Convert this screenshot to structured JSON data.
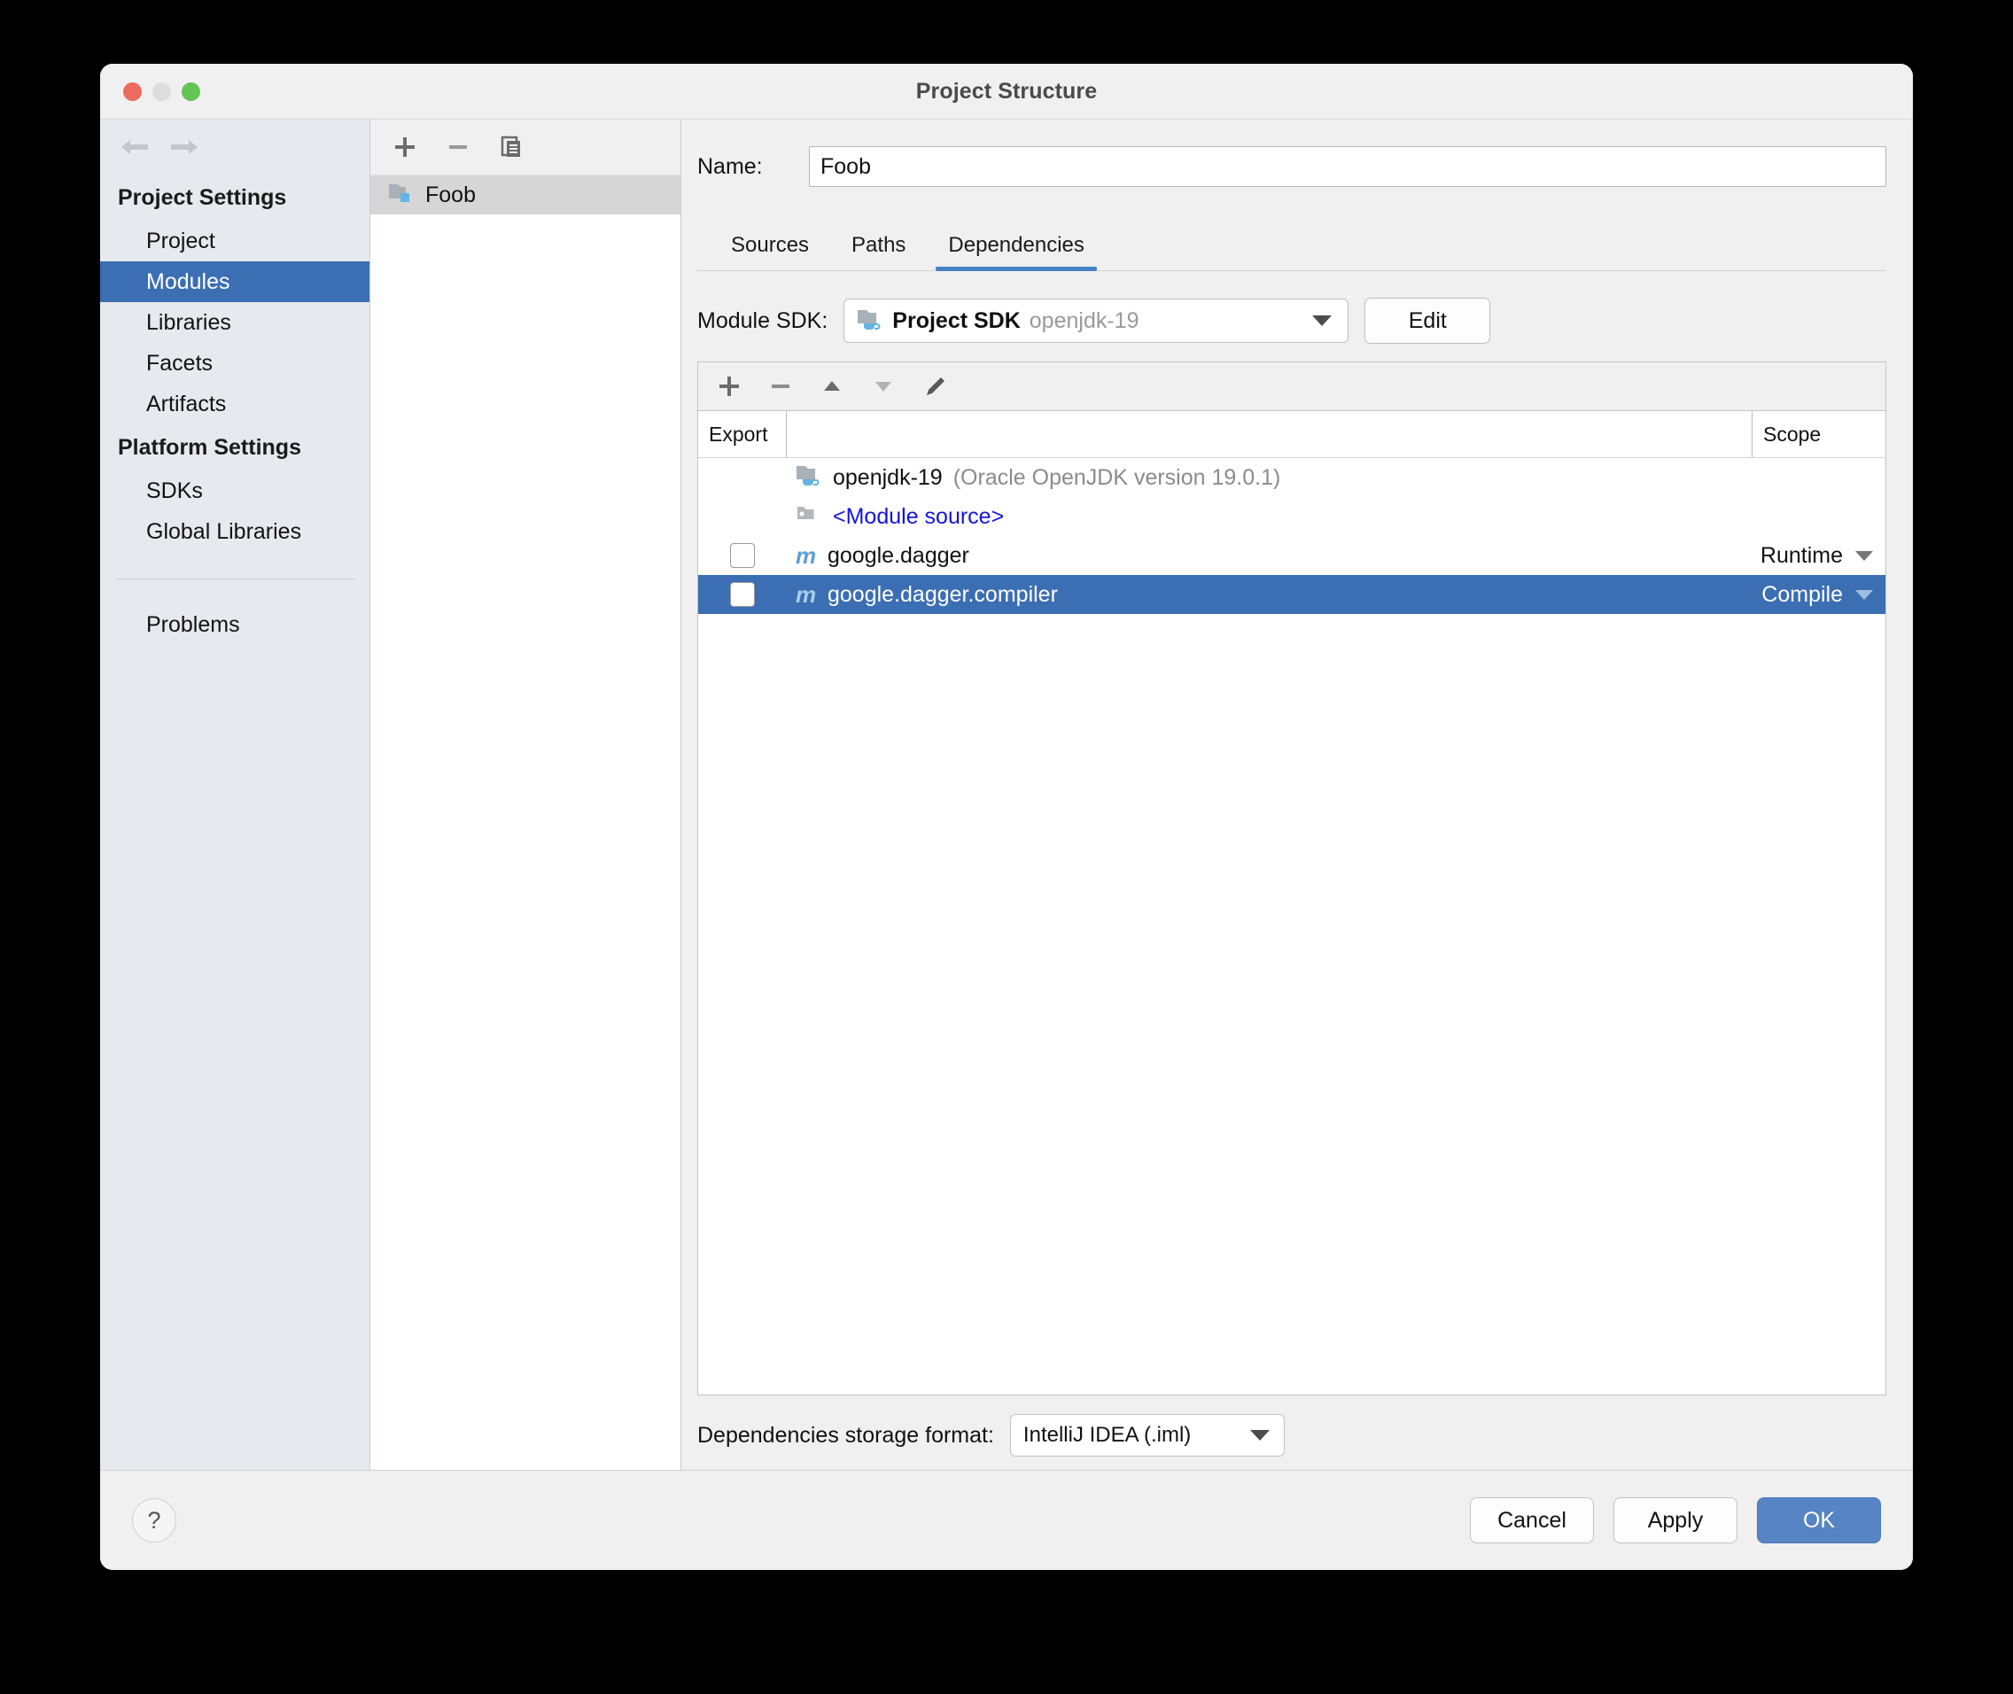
{
  "window": {
    "title": "Project Structure",
    "traffic_lights": [
      "close-button",
      "minimize-button",
      "zoom-button"
    ]
  },
  "sidebar": {
    "nav": {
      "back": "back-arrow",
      "forward": "forward-arrow"
    },
    "groups": [
      {
        "header": "Project Settings",
        "items": [
          "Project",
          "Modules",
          "Libraries",
          "Facets",
          "Artifacts"
        ]
      },
      {
        "header": "Platform Settings",
        "items": [
          "SDKs",
          "Global Libraries"
        ]
      }
    ],
    "selected": "Modules",
    "extra_item": "Problems"
  },
  "modules_panel": {
    "toolbar": {
      "add": "+",
      "remove": "−",
      "copy": "copy-icon"
    },
    "tree": [
      {
        "label": "Foob",
        "icon": "module-folder-icon",
        "selected": true
      }
    ]
  },
  "content": {
    "name_label": "Name:",
    "name_value": "Foob",
    "name_placeholder": "",
    "tabs": [
      {
        "label": "Sources",
        "active": false
      },
      {
        "label": "Paths",
        "active": false
      },
      {
        "label": "Dependencies",
        "active": true
      }
    ],
    "sdk": {
      "label": "Module SDK:",
      "value_main": "Project SDK",
      "value_sub": "openjdk-19",
      "edit_label": "Edit"
    },
    "dependencies": {
      "toolbar": [
        "add-icon",
        "remove-icon",
        "move-up-icon",
        "move-down-icon",
        "edit-pencil-icon"
      ],
      "columns": {
        "export": "Export",
        "name": "",
        "scope": "Scope"
      },
      "rows": [
        {
          "export": null,
          "icon": "sdk-folder-icon",
          "name": "openjdk-19",
          "detail": "(Oracle OpenJDK version 19.0.1)",
          "scope": "",
          "selected": false,
          "link": false
        },
        {
          "export": null,
          "icon": "module-source-icon",
          "name": "<Module source>",
          "detail": "",
          "scope": "",
          "selected": false,
          "link": true
        },
        {
          "export": false,
          "icon": "maven-icon",
          "name": "google.dagger",
          "detail": "",
          "scope": "Runtime",
          "selected": false,
          "link": false
        },
        {
          "export": false,
          "icon": "maven-icon",
          "name": "google.dagger.compiler",
          "detail": "",
          "scope": "Compile",
          "selected": true,
          "link": false
        }
      ]
    },
    "storage": {
      "label": "Dependencies storage format:",
      "value": "IntelliJ IDEA (.iml)"
    }
  },
  "footer": {
    "help_label": "?",
    "buttons": [
      {
        "label": "Cancel",
        "style": "light"
      },
      {
        "label": "Apply",
        "style": "light"
      },
      {
        "label": "OK",
        "style": "primary"
      }
    ]
  },
  "colors": {
    "accent": "#3c6eb4",
    "tab_underline": "#4681c6",
    "primary_button": "#5684c4",
    "link": "#1414d8",
    "muted_text": "#8b8b8b",
    "sidebar_bg": "#e6e9ed",
    "window_bg": "#f0f0f0"
  }
}
